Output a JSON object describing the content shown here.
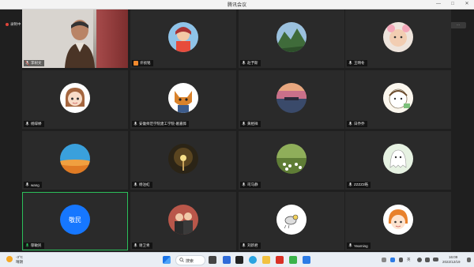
{
  "window": {
    "title": "腾讯会议",
    "minimize": "—",
    "maximize": "□",
    "close": "✕"
  },
  "top_left_label": "录制中",
  "top_right_label": "正在讲话: 郁敏民",
  "tiles": [
    {
      "name": "李树文",
      "type": "video",
      "muted": true
    },
    {
      "name": "许祯铭",
      "type": "avatar",
      "avatar": "girl-cartoon",
      "host": true
    },
    {
      "name": "赵予斯",
      "type": "avatar",
      "avatar": "landscape-photo"
    },
    {
      "name": "王晴冬",
      "type": "avatar",
      "avatar": "child-photo"
    },
    {
      "name": "杨辞婷",
      "type": "avatar",
      "avatar": "anime-girl"
    },
    {
      "name": "安徽师范学院建工学院-葛嘉骅",
      "type": "avatar",
      "avatar": "fox-cartoon"
    },
    {
      "name": "黄相祥",
      "type": "avatar",
      "avatar": "sunset-lake"
    },
    {
      "name": "日乔乔",
      "type": "avatar",
      "avatar": "cute-sketch"
    },
    {
      "name": "wang",
      "type": "avatar",
      "avatar": "orange-sky"
    },
    {
      "name": "杨泊虹",
      "type": "avatar",
      "avatar": "lamp-photo"
    },
    {
      "name": "司马静",
      "type": "avatar",
      "avatar": "flower-field"
    },
    {
      "name": "ZZZZ2皓",
      "type": "avatar",
      "avatar": "ghost-cartoon"
    },
    {
      "name": "郁敏民",
      "type": "avatar-text",
      "avatar_text": "敬民",
      "speaking": true
    },
    {
      "name": "谢卫青",
      "type": "avatar",
      "avatar": "couple-photo"
    },
    {
      "name": "刘新君",
      "type": "avatar",
      "avatar": "bird-sketch"
    },
    {
      "name": "Yearning",
      "type": "avatar",
      "avatar": "girl-orange"
    }
  ],
  "taskbar": {
    "weather_temp": "-3°C",
    "weather_desc": "晴朗",
    "search_label": "搜索",
    "time": "16:09",
    "date": "2022/12/19",
    "lang": "英"
  },
  "colors": {
    "speaking_border": "#2bbf5a",
    "host_badge": "#f28a2e",
    "text_avatar": "#1677ff"
  }
}
